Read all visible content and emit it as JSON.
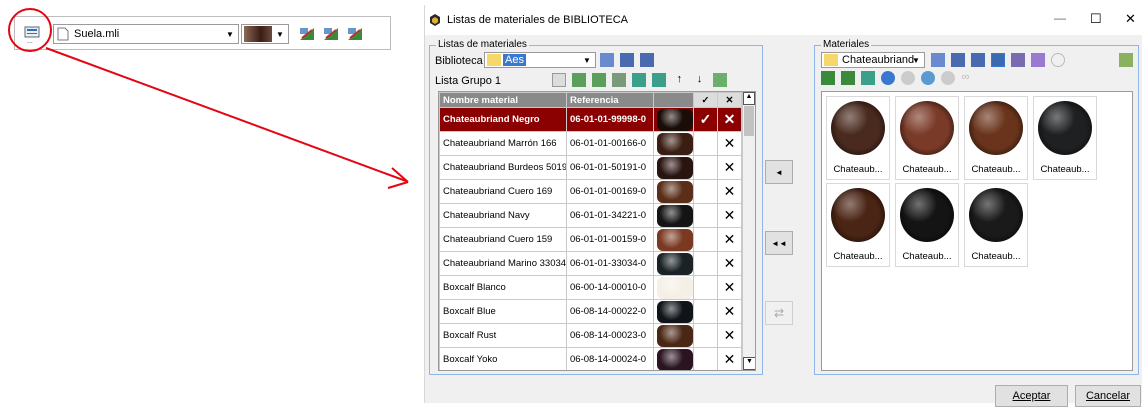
{
  "toolbar": {
    "file_value": "Suela.mli",
    "colors": {
      "accent": "#e30613",
      "selection": "#8b0000",
      "header": "#8a8a8a",
      "group_border": "#8fb6e6"
    }
  },
  "dialog": {
    "title": "Listas de materiales de BIBLIOTECA",
    "left_group_label": "Listas de materiales",
    "biblioteca_label": "Biblioteca",
    "biblioteca_value": "Aes",
    "lista_value": "Lista Grupo 1",
    "columns": {
      "name": "Nombre material",
      "ref": "Referencia",
      "check": "✓",
      "x": "✕"
    },
    "rows": [
      {
        "name": "Chateaubriand Negro",
        "ref": "06-01-01-99998-0",
        "color": "#1a0d08",
        "selected": true
      },
      {
        "name": "Chateaubriand Marrón 166",
        "ref": "06-01-01-00166-0",
        "color": "#3a1e14"
      },
      {
        "name": "Chateaubriand Burdeos 50191",
        "ref": "06-01-01-50191-0",
        "color": "#2a1410"
      },
      {
        "name": "Chateaubriand Cuero 169",
        "ref": "06-01-01-00169-0",
        "color": "#5a2e18"
      },
      {
        "name": "Chateaubriand Navy",
        "ref": "06-01-01-34221-0",
        "color": "#141414"
      },
      {
        "name": "Chateaubriand Cuero 159",
        "ref": "06-01-01-00159-0",
        "color": "#7a3a22"
      },
      {
        "name": "Chateaubriand Marino 33034",
        "ref": "06-01-01-33034-0",
        "color": "#1a2226"
      },
      {
        "name": "Boxcalf Blanco",
        "ref": "06-00-14-00010-0",
        "color": "#f4f0e6"
      },
      {
        "name": "Boxcalf Blue",
        "ref": "06-08-14-00022-0",
        "color": "#101418"
      },
      {
        "name": "Boxcalf Rust",
        "ref": "06-08-14-00023-0",
        "color": "#4a2614"
      },
      {
        "name": "Boxcalf Yoko",
        "ref": "06-08-14-00024-0",
        "color": "#2a1420"
      }
    ],
    "right_group_label": "Materiales",
    "materiales_value": "Chateaubriand",
    "cards": [
      {
        "label": "Chateaub...",
        "color": "#4a2a1e"
      },
      {
        "label": "Chateaub...",
        "color": "#7a3a28"
      },
      {
        "label": "Chateaub...",
        "color": "#6a341c"
      },
      {
        "label": "Chateaub...",
        "color": "#1e2022"
      },
      {
        "label": "Chateaub...",
        "color": "#4a2414"
      },
      {
        "label": "Chateaub...",
        "color": "#141414"
      },
      {
        "label": "Chateaub...",
        "color": "#1a1a1a"
      }
    ],
    "accept_label": "Aceptar",
    "cancel_label": "Cancelar",
    "minimize_glyph": "—",
    "maximize_glyph": "☐",
    "close_glyph": "✕",
    "move_left_glyph": "◄",
    "move_all_glyph": "◄◄"
  }
}
